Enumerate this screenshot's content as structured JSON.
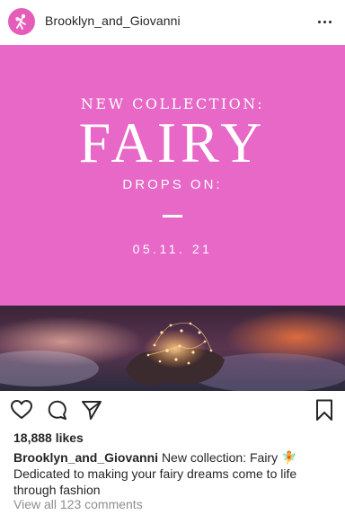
{
  "header": {
    "username": "Brooklyn_and_Giovanni",
    "avatar_icon": "fairy-icon",
    "more_icon": "more-options-icon"
  },
  "post": {
    "promo_line1": "NEW COLLECTION:",
    "promo_title": "FAIRY",
    "promo_line3": "DROPS ON:",
    "promo_date": "05.11. 21",
    "background_color": "#e768c7",
    "photo_description_icon": "fairy-lights-hands-image"
  },
  "actions": {
    "like_icon": "heart-icon",
    "comment_icon": "comment-icon",
    "share_icon": "send-icon",
    "save_icon": "bookmark-icon"
  },
  "likes": "18,888 likes",
  "caption": {
    "author": "Brooklyn_and_Giovanni",
    "text": "New collection: Fairy 🧚",
    "text2": "Dedicated to making your fairy dreams come to life through fashion"
  },
  "comments_link": "View all 123 comments"
}
